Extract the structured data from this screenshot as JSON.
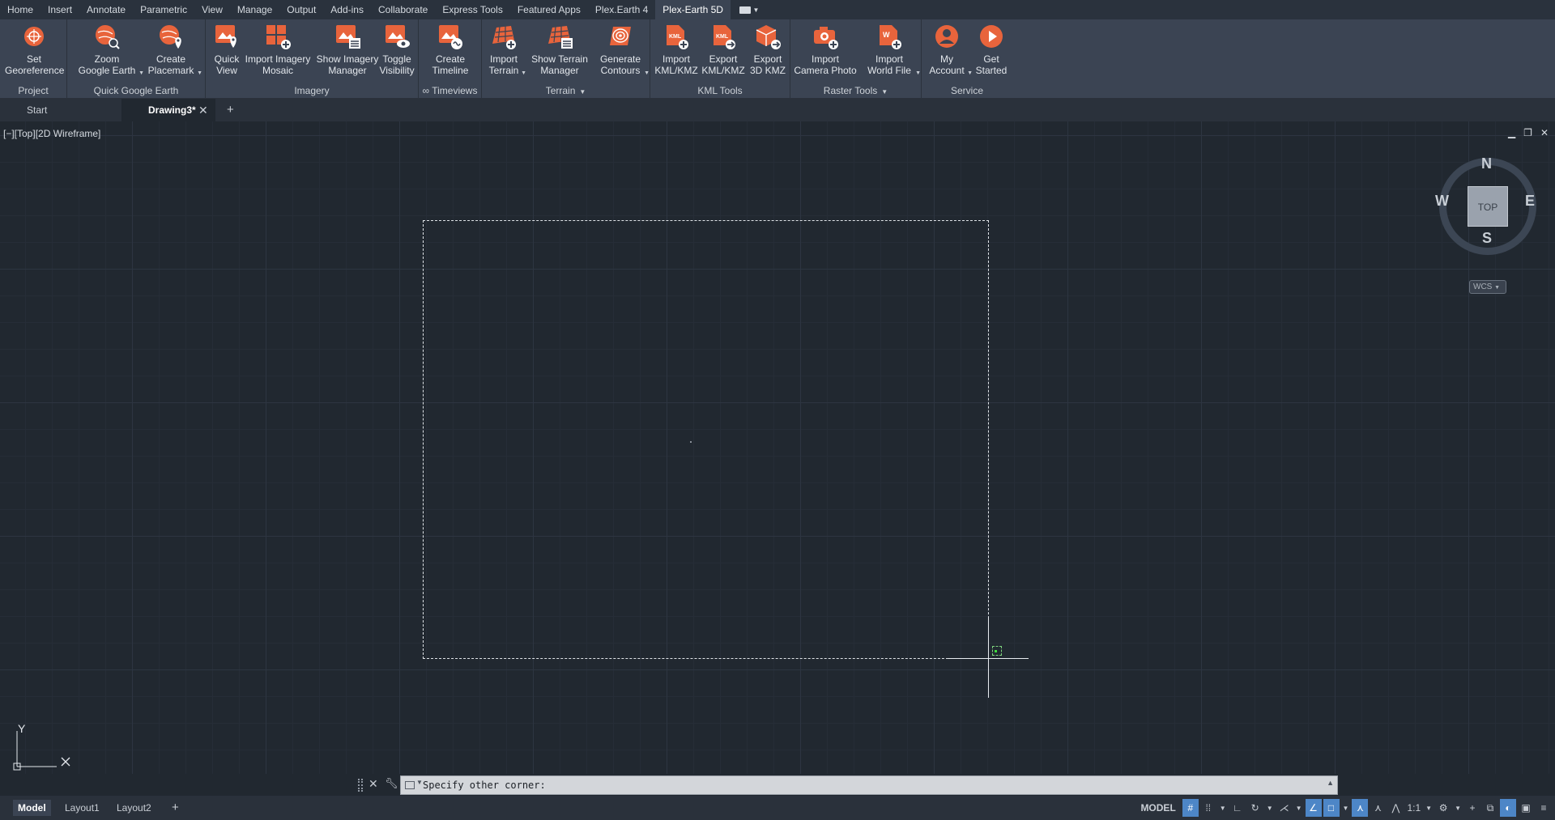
{
  "ribbon_tabs": [
    "Home",
    "Insert",
    "Annotate",
    "Parametric",
    "View",
    "Manage",
    "Output",
    "Add-ins",
    "Collaborate",
    "Express Tools",
    "Featured Apps",
    "Plex.Earth 4",
    "Plex-Earth 5D"
  ],
  "active_ribbon_tab": "Plex-Earth 5D",
  "ribbon_groups": {
    "project": "Project",
    "quick_google_earth": "Quick Google Earth",
    "imagery": "Imagery",
    "timeviews": "∞ Timeviews",
    "terrain": "Terrain",
    "kml_tools": "KML Tools",
    "raster_tools": "Raster Tools",
    "service": "Service"
  },
  "buttons": {
    "set_georeference": "Set\nGeoreference",
    "zoom_google_earth": "Zoom\nGoogle Earth",
    "create_placemark": "Create\nPlacemark",
    "quick_view": "Quick\nView",
    "import_imagery_mosaic": "Import Imagery\nMosaic",
    "show_imagery_manager": "Show Imagery\nManager",
    "toggle_visibility": "Toggle\nVisibility",
    "create_timeline": "Create\nTimeline",
    "import_terrain": "Import\nTerrain",
    "show_terrain_manager": "Show Terrain\nManager",
    "generate_contours": "Generate\nContours",
    "import_kml_kmz": "Import\nKML/KMZ",
    "export_kml_kmz": "Export\nKML/KMZ",
    "export_3d_kmz": "Export\n3D KMZ",
    "import_camera_photo": "Import\nCamera Photo",
    "import_world_file": "Import\nWorld File",
    "my_account": "My\nAccount",
    "get_started": "Get\nStarted"
  },
  "icon_text": {
    "kml": "KML",
    "world": "W"
  },
  "file_tabs": {
    "start": "Start",
    "drawing": "Drawing3*"
  },
  "viewport_label": "[−][Top][2D Wireframe]",
  "viewcube": {
    "face": "TOP",
    "north": "N",
    "south": "S",
    "east": "E",
    "west": "W",
    "wcs": "WCS"
  },
  "ucs": {
    "y": "Y",
    "x": "X"
  },
  "command_prompt": "Specify other corner:",
  "layout_tabs": [
    "Model",
    "Layout1",
    "Layout2"
  ],
  "status": {
    "model": "MODEL",
    "scale": "1:1"
  },
  "colors": {
    "accent": "#e8643c",
    "ribbon_bg": "#3b4453",
    "canvas_bg": "#212830",
    "status_on": "#4d86c7"
  }
}
